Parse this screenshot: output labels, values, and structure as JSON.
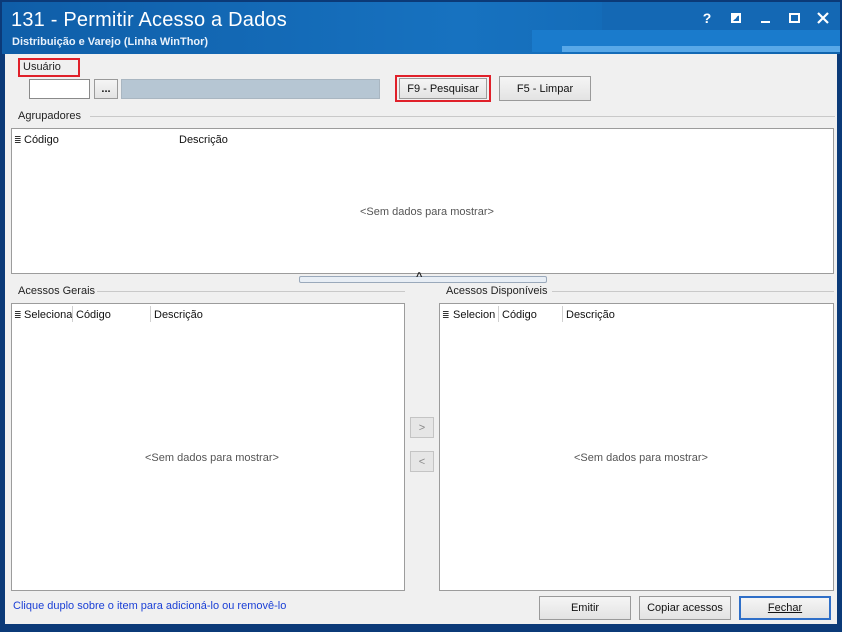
{
  "window": {
    "title": "131 - Permitir Acesso a Dados",
    "subtitle": "Distribuição e Varejo (Linha WinThor)",
    "help_glyph": "?",
    "icons": [
      "restore-icon",
      "minimize-icon",
      "maximize-icon",
      "close-icon"
    ]
  },
  "usuario": {
    "label": "Usuário",
    "code_value": "",
    "name_value": "",
    "lookup_label": "..."
  },
  "toolbar": {
    "search_label": "F9 - Pesquisar",
    "clear_label": "F5 - Limpar"
  },
  "agrupadores": {
    "title": "Agrupadores",
    "columns": [
      "Código",
      "Descrição"
    ],
    "empty_text": "<Sem dados para mostrar>"
  },
  "acessos_gerais": {
    "title": "Acessos Gerais",
    "columns": [
      "Seleciona",
      "Código",
      "Descrição"
    ],
    "empty_text": "<Sem dados para mostrar>"
  },
  "acessos_disponiveis": {
    "title": "Acessos Disponíveis",
    "columns": [
      "Selecion",
      "Código",
      "Descrição"
    ],
    "empty_text": "<Sem dados para mostrar>"
  },
  "transfer": {
    "add_label": ">",
    "remove_label": "<"
  },
  "splitter": {
    "glyph": "^"
  },
  "footer": {
    "hint": "Clique duplo sobre o item para adicioná-lo ou removê-lo",
    "emit_label": "Emitir",
    "copy_label": "Copiar acessos",
    "close_label": "Fechar"
  },
  "colors": {
    "title_bar": "#1772c0",
    "frame": "#0b3a78",
    "highlight": "#e0202a",
    "hint_text": "#1a3fd6"
  }
}
